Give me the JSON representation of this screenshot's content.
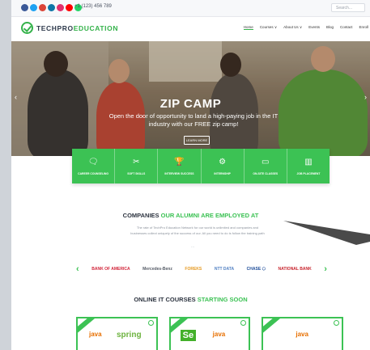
{
  "topbar": {
    "phone": "+1 (123) 456 789",
    "search_placeholder": "Search..."
  },
  "brand": {
    "logo_prefix": "TECHPRO",
    "logo_suffix": "EDUCATION",
    "accent_color": "#3cc254"
  },
  "nav": {
    "items": [
      "Home",
      "Courses ∨",
      "About Us ∨",
      "Events",
      "Blog",
      "Contact",
      "Enroll"
    ]
  },
  "hero": {
    "title": "ZIP CAMP",
    "subtitle": "Open the door of opportunity to land a high-paying job in the IT industry with our FREE zip camp!",
    "button": "LEARN MORE"
  },
  "features": [
    {
      "icon": "chat-icon",
      "glyph": "🗨",
      "label": "CAREER COUNSELING"
    },
    {
      "icon": "tools-icon",
      "glyph": "✂",
      "label": "SOFT SKILLS"
    },
    {
      "icon": "trophy-icon",
      "glyph": "🏆",
      "label": "INTERVIEW SUCCESS"
    },
    {
      "icon": "gear-icon",
      "glyph": "⚙",
      "label": "INTERNSHIP"
    },
    {
      "icon": "slides-icon",
      "glyph": "▭",
      "label": "ON-SITE CLASSES"
    },
    {
      "icon": "book-icon",
      "glyph": "▥",
      "label": "JOB PLACEMENT"
    }
  ],
  "companies": {
    "title_plain": "COMPANIES ",
    "title_green": "OUR ALUMNI ARE EMPLOYED AT",
    "text": "The rate of TechPro Education Network for our world is unlimited and companies and businesses collect uniquely of the success of our. All you need to do is follow the training path",
    "more": "···",
    "logos": [
      {
        "name": "BANK OF AMERICA",
        "color": "#d2253a"
      },
      {
        "name": "Mercedes-Benz",
        "color": "#555b66"
      },
      {
        "name": "FOREKS",
        "color": "#e69a22"
      },
      {
        "name": "NTT DATA",
        "color": "#4f7fc2"
      },
      {
        "name": "CHASE ⬡",
        "color": "#1d4c99"
      },
      {
        "name": "NATIONAL BANK",
        "color": "#c8232c"
      }
    ]
  },
  "courses": {
    "title_plain": "ONLINE IT COURSES ",
    "title_green": "STARTING SOON",
    "cards": [
      {
        "left": "java",
        "right": "spring"
      },
      {
        "left": "Se",
        "right": "java"
      },
      {
        "left": "java",
        "right": ""
      }
    ]
  }
}
